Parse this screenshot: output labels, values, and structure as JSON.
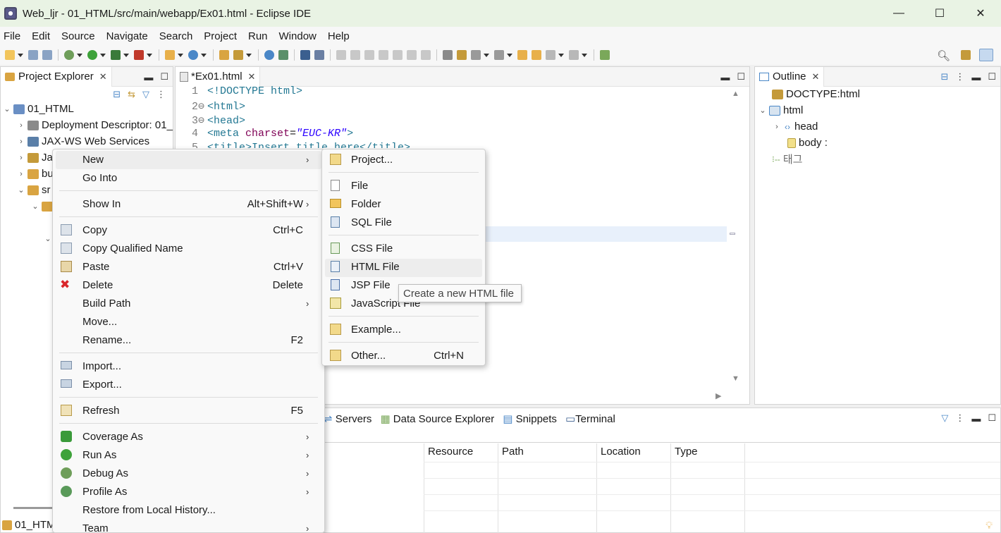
{
  "window": {
    "title": "Web_ljr - 01_HTML/src/main/webapp/Ex01.html - Eclipse IDE",
    "minimize": "—",
    "maximize": "☐",
    "close": "✕"
  },
  "menubar": [
    "File",
    "Edit",
    "Source",
    "Navigate",
    "Search",
    "Project",
    "Run",
    "Window",
    "Help"
  ],
  "project_explorer": {
    "tab_label": "Project Explorer",
    "items": [
      {
        "label": "01_HTML"
      },
      {
        "label": "Deployment Descriptor: 01_"
      },
      {
        "label": "JAX-WS Web Services"
      },
      {
        "label": "Ja"
      },
      {
        "label": "bu"
      },
      {
        "label": "sr"
      }
    ],
    "bottom_label": "01_HTM"
  },
  "editor": {
    "tab_label": "*Ex01.html",
    "lines": [
      {
        "num": "1",
        "text": "<!DOCTYPE html>"
      },
      {
        "num": "2⊖",
        "text": "<html>"
      },
      {
        "num": "3⊖",
        "text": "<head>"
      },
      {
        "num": "4",
        "pre": "<meta ",
        "attr": "charset",
        "eq": "=",
        "val": "\"EUC-KR\"",
        "post": ">"
      },
      {
        "num": "5",
        "text": "<title>Insert title here</title>"
      }
    ]
  },
  "outline": {
    "tab_label": "Outline",
    "items": [
      {
        "label": "DOCTYPE:html"
      },
      {
        "label": "html"
      },
      {
        "label": "head"
      },
      {
        "label": "body :"
      },
      {
        "label": "태그"
      }
    ]
  },
  "bottom_panel": {
    "tabs": [
      "Servers",
      "Data Source Explorer",
      "Snippets",
      "Terminal"
    ],
    "columns": [
      "Resource",
      "Path",
      "Location",
      "Type"
    ]
  },
  "context_menu": {
    "items": [
      {
        "label": "New",
        "shortcut": ""
      },
      {
        "label": "Go Into",
        "shortcut": ""
      },
      {
        "label": "Show In",
        "shortcut": "Alt+Shift+W"
      },
      {
        "label": "Copy",
        "shortcut": "Ctrl+C"
      },
      {
        "label": "Copy Qualified Name",
        "shortcut": ""
      },
      {
        "label": "Paste",
        "shortcut": "Ctrl+V"
      },
      {
        "label": "Delete",
        "shortcut": "Delete"
      },
      {
        "label": "Build Path",
        "shortcut": ""
      },
      {
        "label": "Move...",
        "shortcut": ""
      },
      {
        "label": "Rename...",
        "shortcut": "F2"
      },
      {
        "label": "Import...",
        "shortcut": ""
      },
      {
        "label": "Export...",
        "shortcut": ""
      },
      {
        "label": "Refresh",
        "shortcut": "F5"
      },
      {
        "label": "Coverage As",
        "shortcut": ""
      },
      {
        "label": "Run As",
        "shortcut": ""
      },
      {
        "label": "Debug As",
        "shortcut": ""
      },
      {
        "label": "Profile As",
        "shortcut": ""
      },
      {
        "label": "Restore from Local History...",
        "shortcut": ""
      },
      {
        "label": "Team",
        "shortcut": ""
      }
    ]
  },
  "submenu_new": {
    "items": [
      {
        "label": "Project...",
        "shortcut": ""
      },
      {
        "label": "File",
        "shortcut": ""
      },
      {
        "label": "Folder",
        "shortcut": ""
      },
      {
        "label": "SQL File",
        "shortcut": ""
      },
      {
        "label": "CSS File",
        "shortcut": ""
      },
      {
        "label": "HTML File",
        "shortcut": ""
      },
      {
        "label": "JSP File",
        "shortcut": ""
      },
      {
        "label": "JavaScript File",
        "shortcut": ""
      },
      {
        "label": "Example...",
        "shortcut": ""
      },
      {
        "label": "Other...",
        "shortcut": "Ctrl+N"
      }
    ]
  },
  "tooltip": "Create a new HTML file",
  "colors": {
    "titlebar_bg": "#e9f3e4",
    "menu_hover": "#ededed",
    "delete_icon": "#d9262b"
  }
}
